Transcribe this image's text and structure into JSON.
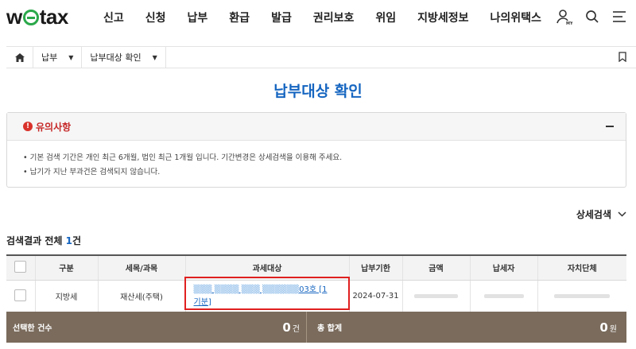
{
  "header": {
    "logo": {
      "pre": "w",
      "post": "tax"
    },
    "nav": [
      "신고",
      "신청",
      "납부",
      "환급",
      "발급",
      "권리보호",
      "위임",
      "지방세정보",
      "나의위택스"
    ],
    "icons": [
      "user-my-icon",
      "search-icon",
      "menu-icon"
    ]
  },
  "breadcrumb": {
    "items": [
      "납부",
      "납부대상 확인"
    ]
  },
  "page": {
    "title": "납부대상 확인"
  },
  "notice": {
    "title": "유의사항",
    "items": [
      "기본 검색 기간은 개인 최근 6개월, 법인 최근 1개월 입니다. 기간변경은 상세검색을 이용해 주세요.",
      "납기가 지난 부과건은 검색되지 않습니다."
    ]
  },
  "detail_search": {
    "label": "상세검색"
  },
  "results": {
    "prefix": "검색결과 전체",
    "count": "1",
    "suffix": "건"
  },
  "table": {
    "headers": [
      "구분",
      "세목/과목",
      "과세대상",
      "납부기한",
      "금액",
      "납세자",
      "자치단체"
    ],
    "rows": [
      {
        "type": "지방세",
        "tax": "재산세(주택)",
        "target_visible": "03호 [1",
        "target_line2": "기분]",
        "due": "2024-07-31"
      }
    ]
  },
  "summary": {
    "selected_label": "선택한 건수",
    "selected_value": "0",
    "selected_unit": "건",
    "total_label": "총 합계",
    "total_value": "0",
    "total_unit": "원"
  },
  "colors": {
    "accent": "#1565c0",
    "alert": "#c62828",
    "summary_bg": "#7a6b5c",
    "highlight": "#e02020"
  }
}
